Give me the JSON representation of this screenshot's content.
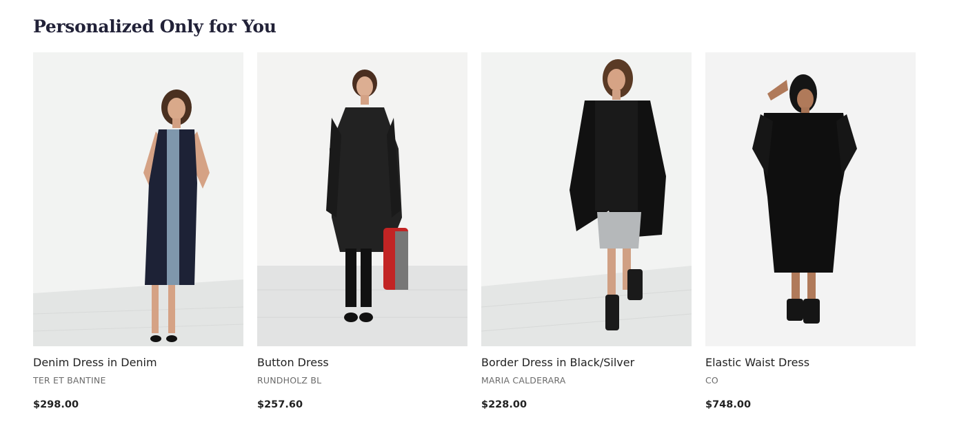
{
  "section": {
    "title": "Personalized Only for You"
  },
  "products": [
    {
      "name": "Denim Dress in Denim",
      "brand": "TER ET BANTINE",
      "price": "$298.00",
      "image_icon": "model-photo"
    },
    {
      "name": "Button Dress",
      "brand": "RUNDHOLZ BL",
      "price": "$257.60",
      "image_icon": "model-photo"
    },
    {
      "name": "Border Dress in Black/Silver",
      "brand": "MARIA CALDERARA",
      "price": "$228.00",
      "image_icon": "model-photo"
    },
    {
      "name": "Elastic Waist Dress",
      "brand": "CO",
      "price": "$748.00",
      "image_icon": "model-photo"
    }
  ],
  "colors": {
    "title": "#222238",
    "text": "#222222",
    "brand": "#6a6a6a",
    "photo_bg": "#eeefee"
  }
}
